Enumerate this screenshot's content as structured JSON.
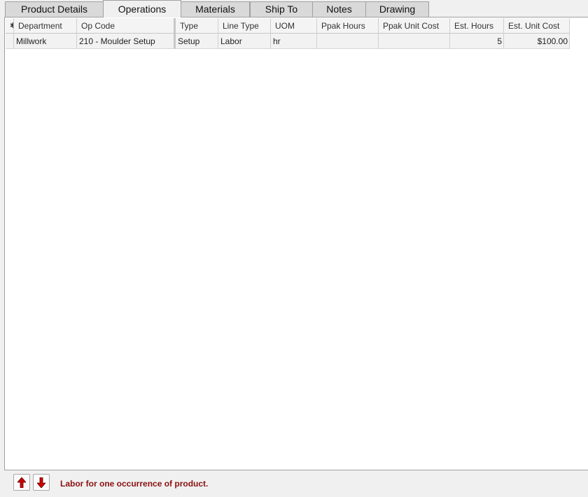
{
  "tabs": [
    {
      "label": "Product Details",
      "active": false
    },
    {
      "label": "Operations",
      "active": true
    },
    {
      "label": "Materials",
      "active": false
    },
    {
      "label": "Ship To",
      "active": false
    },
    {
      "label": "Notes",
      "active": false
    },
    {
      "label": "Drawing",
      "active": false
    }
  ],
  "grid": {
    "new_row_marker": "✱",
    "columns": [
      "Department",
      "Op Code",
      "Type",
      "Line Type",
      "UOM",
      "Ppak Hours",
      "Ppak Unit Cost",
      "Est. Hours",
      "Est. Unit Cost"
    ],
    "rows": [
      [
        "Millwork",
        "210 - Moulder Setup",
        "Setup",
        "Labor",
        "hr",
        "",
        "",
        "5",
        "$100.00"
      ]
    ]
  },
  "footer": {
    "status_text": "Labor for one occurrence of product.",
    "up_icon": "move-up-arrow-icon",
    "down_icon": "move-down-arrow-icon",
    "arrow_color": "#cc0000"
  }
}
